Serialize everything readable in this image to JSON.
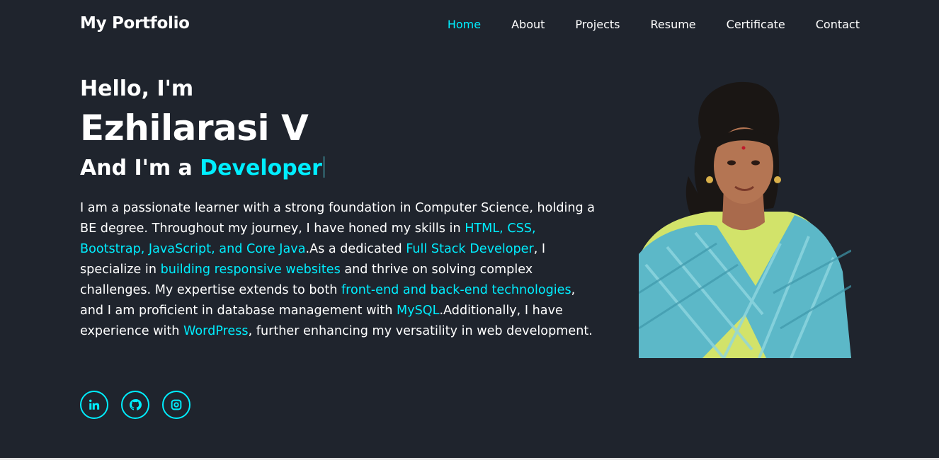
{
  "header": {
    "logo": "My Portfolio",
    "nav": [
      {
        "label": "Home",
        "active": true
      },
      {
        "label": "About"
      },
      {
        "label": "Projects"
      },
      {
        "label": "Resume"
      },
      {
        "label": "Certificate"
      },
      {
        "label": "Contact"
      }
    ]
  },
  "hero": {
    "greeting": "Hello, I'm",
    "name": "Ezhilarasi V",
    "role_prefix": "And I'm a ",
    "role": "Developer",
    "description": [
      {
        "t": "I am a passionate learner with a strong foundation in Computer Science, holding a BE degree. Throughout my journey, I have honed my skills in "
      },
      {
        "t": "HTML, CSS, Bootstrap, JavaScript, and Core Java",
        "hl": true
      },
      {
        "t": ".As a dedicated "
      },
      {
        "t": "Full Stack Developer",
        "hl": true
      },
      {
        "t": ", I specialize in "
      },
      {
        "t": "building responsive websites",
        "hl": true
      },
      {
        "t": " and thrive on solving complex challenges. My expertise extends to both "
      },
      {
        "t": "front-end and back-end technologies",
        "hl": true
      },
      {
        "t": ", and I am proficient in database management with "
      },
      {
        "t": "MySQL",
        "hl": true
      },
      {
        "t": ".Additionally, I have experience with "
      },
      {
        "t": "WordPress",
        "hl": true
      },
      {
        "t": ", further enhancing my versatility in web development."
      }
    ]
  },
  "social": [
    {
      "icon": "linkedin-icon"
    },
    {
      "icon": "github-icon"
    },
    {
      "icon": "instagram-icon"
    }
  ],
  "colors": {
    "background": "#1f242d",
    "accent": "#00eeff",
    "text": "#ffffff"
  }
}
